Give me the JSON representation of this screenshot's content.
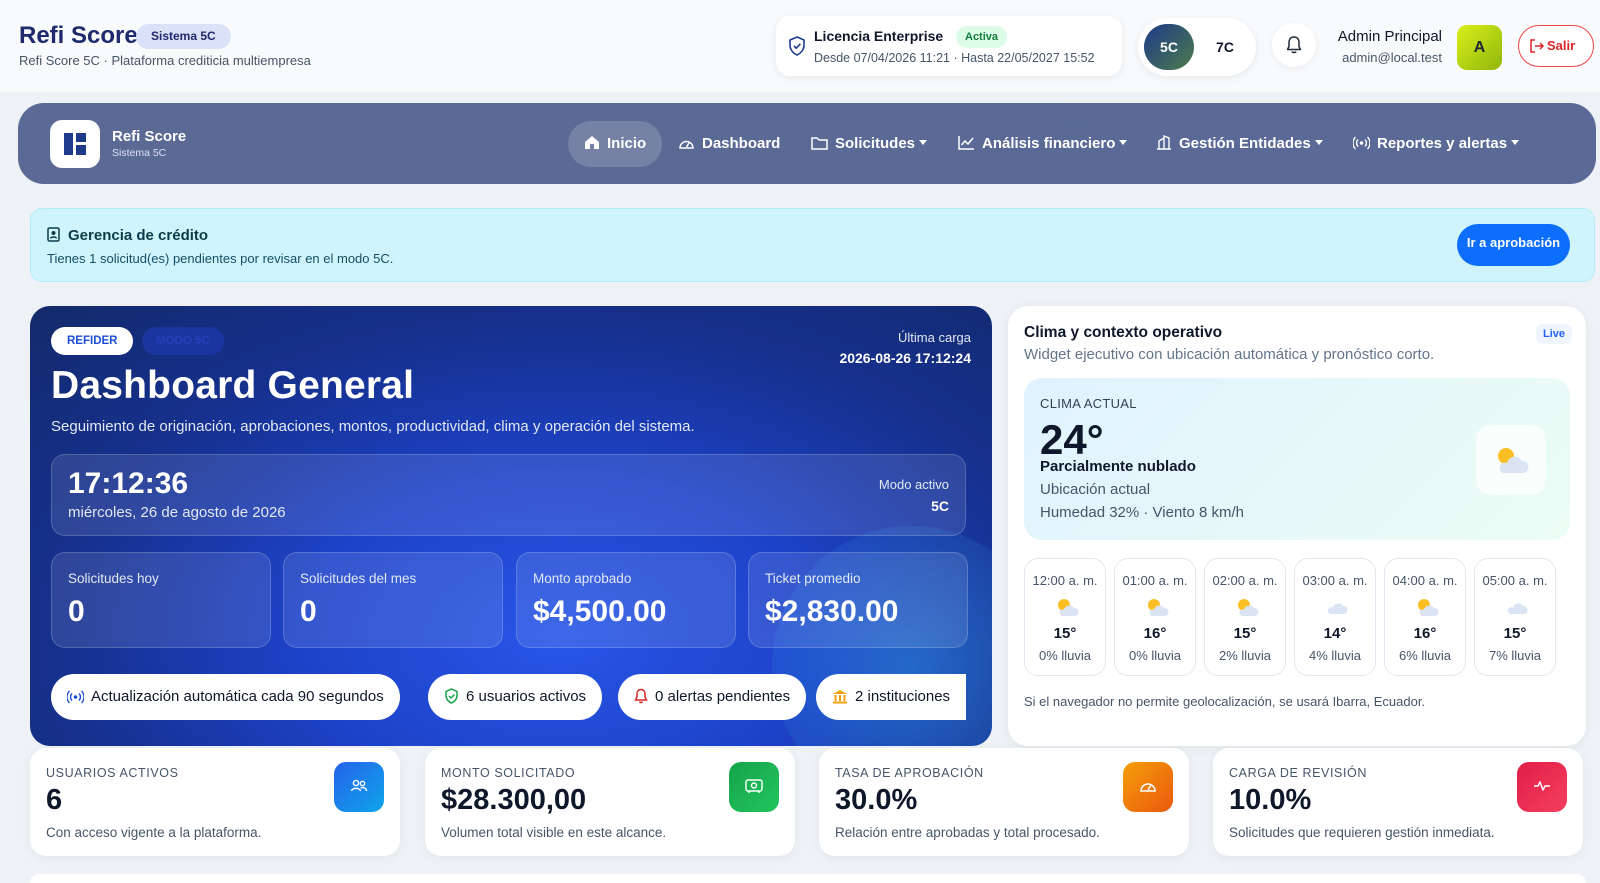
{
  "header": {
    "title": "Refi Score",
    "badge": "Sistema 5C",
    "subtitle": "Refi Score 5C · Plataforma crediticia multiempresa",
    "license": {
      "title": "Licencia Enterprise",
      "status": "Activa",
      "dates": "Desde 07/04/2026 11:21 · Hasta 22/05/2027 15:52"
    },
    "modes": [
      "5C",
      "7C"
    ],
    "user": {
      "name": "Admin Principal",
      "email": "admin@local.test",
      "initial": "A"
    },
    "logout_label": "Salir"
  },
  "nav": {
    "brand": "Refi Score",
    "brand_sub": "Sistema 5C",
    "items": [
      {
        "label": "Inicio",
        "icon": "home-icon"
      },
      {
        "label": "Dashboard",
        "icon": "gauge-icon"
      },
      {
        "label": "Solicitudes",
        "icon": "folder-icon"
      },
      {
        "label": "Análisis financiero",
        "icon": "chart-line-icon"
      },
      {
        "label": "Gestión Entidades",
        "icon": "building-icon"
      },
      {
        "label": "Reportes y alertas",
        "icon": "broadcast-icon"
      }
    ]
  },
  "alert": {
    "title": "Gerencia de crédito",
    "text": "Tienes 1 solicitud(es) pendientes por revisar en el modo 5C.",
    "button": "Ir a aprobación"
  },
  "hero": {
    "chip_primary": "REFIDER",
    "chip_secondary": "MODO 5C",
    "last_load_label": "Última carga",
    "last_load_value": "2026-08-26 17:12:24",
    "title": "Dashboard General",
    "description": "Seguimiento de originación, aprobaciones, montos, productividad, clima y operación del sistema.",
    "clock_time": "17:12:36",
    "clock_date": "miércoles, 26 de agosto de 2026",
    "mode_label": "Modo activo",
    "mode_value": "5C",
    "stats": [
      {
        "label": "Solicitudes hoy",
        "value": "0"
      },
      {
        "label": "Solicitudes del mes",
        "value": "0"
      },
      {
        "label": "Monto aprobado",
        "value": "$4,500.00"
      },
      {
        "label": "Ticket promedio",
        "value": "$2,830.00"
      }
    ],
    "pills": [
      "Actualización automática cada 90 segundos",
      "6 usuarios activos",
      "0 alertas pendientes",
      "2 instituciones"
    ]
  },
  "weather": {
    "title": "Clima y contexto operativo",
    "live": "Live",
    "subtitle": "Widget ejecutivo con ubicación automática y pronóstico corto.",
    "current_label": "CLIMA ACTUAL",
    "current_temp": "24°",
    "current_desc": "Parcialmente nublado",
    "location": "Ubicación actual",
    "details": "Humedad 32% · Viento 8 km/h",
    "hours": [
      {
        "time": "12:00 a. m.",
        "temp": "15°",
        "rain": "0% lluvia",
        "icon": "sun-cloud-icon"
      },
      {
        "time": "01:00 a. m.",
        "temp": "16°",
        "rain": "0% lluvia",
        "icon": "sun-cloud-icon"
      },
      {
        "time": "02:00 a. m.",
        "temp": "15°",
        "rain": "2% lluvia",
        "icon": "sun-cloud-icon"
      },
      {
        "time": "03:00 a. m.",
        "temp": "14°",
        "rain": "4% lluvia",
        "icon": "cloud-icon"
      },
      {
        "time": "04:00 a. m.",
        "temp": "16°",
        "rain": "6% lluvia",
        "icon": "sun-cloud-icon"
      },
      {
        "time": "05:00 a. m.",
        "temp": "15°",
        "rain": "7% lluvia",
        "icon": "cloud-icon"
      }
    ],
    "note": "Si el navegador no permite geolocalización, se usará Ibarra, Ecuador."
  },
  "kpis": [
    {
      "label": "USUARIOS ACTIVOS",
      "value": "6",
      "desc": "Con acceso vigente a la plataforma.",
      "color": "#1d8fe8",
      "icon": "users-icon"
    },
    {
      "label": "MONTO SOLICITADO",
      "value": "$28.300,00",
      "desc": "Volumen total visible en este alcance.",
      "color": "#16a34a",
      "icon": "cash-icon"
    },
    {
      "label": "TASA DE APROBACIÓN",
      "value": "30.0%",
      "desc": "Relación entre aprobadas y total procesado.",
      "color": "#f59e0b",
      "icon": "gauge-icon"
    },
    {
      "label": "CARGA DE REVISIÓN",
      "value": "10.0%",
      "desc": "Solicitudes que requieren gestión inmediata.",
      "color": "#e11d48",
      "icon": "pulse-icon"
    }
  ]
}
